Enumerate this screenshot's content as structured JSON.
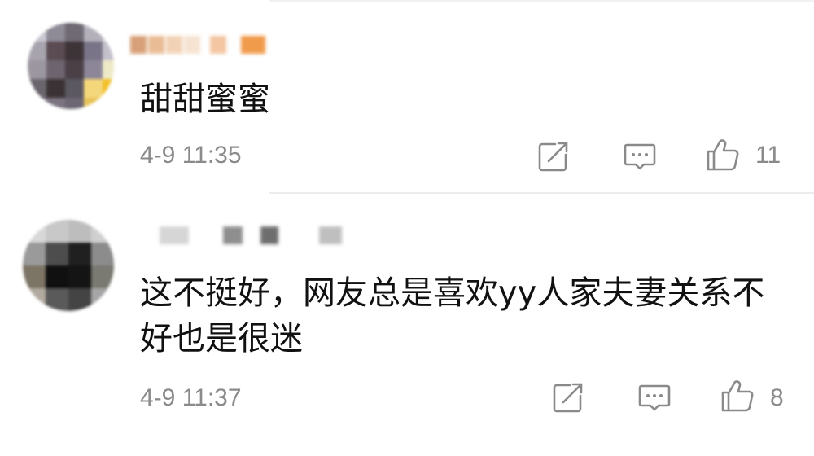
{
  "comments": [
    {
      "text": "甜甜蜜蜜",
      "time": "4-9 11:35",
      "likes": "11"
    },
    {
      "text": "这不挺好，网友总是喜欢yy人家夫妻关系不\n好也是很迷",
      "time": "4-9 11:37",
      "likes": "8"
    }
  ],
  "icons": {
    "share": "share-icon",
    "comment": "comment-icon",
    "like": "thumbs-up-icon"
  },
  "colors": {
    "text": "#111111",
    "meta": "#8a8a8a",
    "divider": "#ececec"
  }
}
